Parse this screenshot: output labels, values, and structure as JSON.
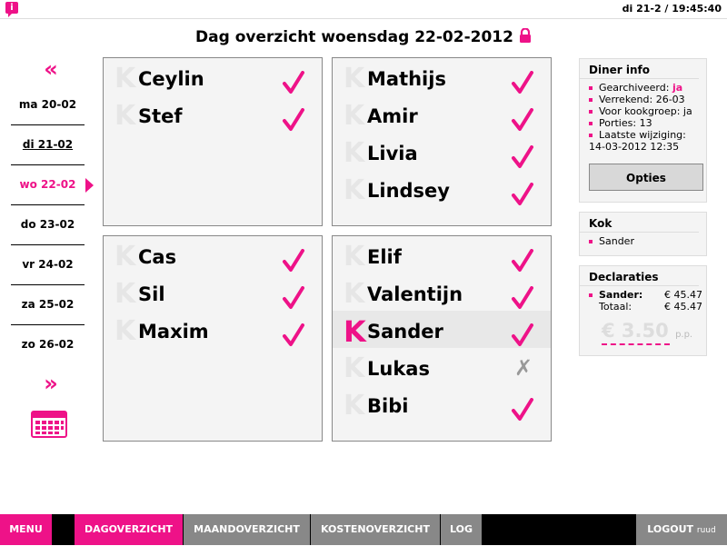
{
  "topbar": {
    "logo_char": "i",
    "datetime": "di 21-2 / 19:45:40"
  },
  "title": "Dag overzicht woensdag 22-02-2012",
  "nav": {
    "prev_label": "«",
    "next_label": "»",
    "days": [
      {
        "label": "ma 20-02",
        "state": "normal"
      },
      {
        "label": "di 21-02",
        "state": "today"
      },
      {
        "label": "wo 22-02",
        "state": "active"
      },
      {
        "label": "do 23-02",
        "state": "normal"
      },
      {
        "label": "vr 24-02",
        "state": "normal"
      },
      {
        "label": "za 25-02",
        "state": "normal"
      },
      {
        "label": "zo 26-02",
        "state": "normal"
      }
    ]
  },
  "groups": [
    {
      "members": [
        {
          "k": "K",
          "name": "Ceylin",
          "status": "check"
        },
        {
          "k": "K",
          "name": "Stef",
          "status": "check"
        }
      ]
    },
    {
      "members": [
        {
          "k": "K",
          "name": "Mathijs",
          "status": "check"
        },
        {
          "k": "K",
          "name": "Amir",
          "status": "check"
        },
        {
          "k": "K",
          "name": "Livia",
          "status": "check"
        },
        {
          "k": "K",
          "name": "Lindsey",
          "status": "check"
        }
      ]
    },
    {
      "members": [
        {
          "k": "K",
          "name": "Cas",
          "status": "check"
        },
        {
          "k": "K",
          "name": "Sil",
          "status": "check"
        },
        {
          "k": "K",
          "name": "Maxim",
          "status": "check"
        }
      ]
    },
    {
      "members": [
        {
          "k": "K",
          "name": "Elif",
          "status": "check"
        },
        {
          "k": "K",
          "name": "Valentijn",
          "status": "check"
        },
        {
          "k": "K",
          "name": "Sander",
          "status": "check",
          "cook": true
        },
        {
          "k": "K",
          "name": "Lukas",
          "status": "cross"
        },
        {
          "k": "K",
          "name": "Bibi",
          "status": "check"
        }
      ]
    }
  ],
  "cross_char": "✗",
  "diner_info": {
    "heading": "Diner info",
    "gearchiveerd_label": "Gearchiveerd:",
    "gearchiveerd_value": "ja",
    "verrekend": "Verrekend: 26-03",
    "kookgroep": "Voor kookgroep: ja",
    "porties": "Porties: 13",
    "wijziging_label": "Laatste wijziging:",
    "wijziging_value": "14-03-2012 12:35",
    "opties_button": "Opties"
  },
  "kok": {
    "heading": "Kok",
    "name": "Sander"
  },
  "declaraties": {
    "heading": "Declaraties",
    "rows": [
      {
        "label": "Sander:",
        "amount": "€ 45.47"
      },
      {
        "label": "Totaal:",
        "amount": "€ 45.47"
      }
    ],
    "per_person": "€ 3.50",
    "per_person_unit": "p.p."
  },
  "bottom": {
    "menu": "MENU",
    "dag": "DAGOVERZICHT",
    "maand": "MAANDOVERZICHT",
    "kosten": "KOSTENOVERZICHT",
    "log": "LOG",
    "logout": "LOGOUT",
    "user": "ruud"
  },
  "colors": {
    "accent": "#ee1288",
    "panel": "#f4f4f4",
    "button_gray": "#888888"
  }
}
